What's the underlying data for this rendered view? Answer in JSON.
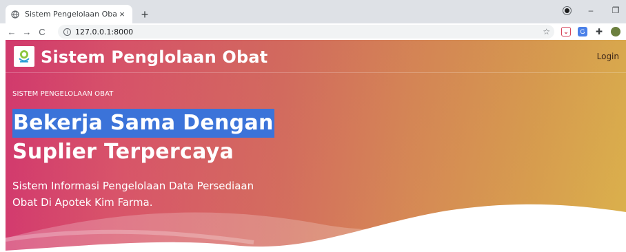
{
  "browser": {
    "tab_title": "Sistem Pengelolaan Obat",
    "tab_close": "×",
    "new_tab": "+",
    "url": "127.0.0.1:8000",
    "back": "←",
    "forward": "→",
    "reload": "C",
    "info": "i",
    "bookmark": "☆",
    "minimize": "–",
    "restore": "❐"
  },
  "navbar": {
    "brand": "Sistem Penglolaan Obat",
    "login": "Login"
  },
  "hero": {
    "kicker": "SISTEM PENGELOLAAN OBAT",
    "headline_line1": "Bekerja Sama Dengan",
    "headline_line2": "Suplier Terpercaya",
    "subtext_line1": "Sistem Informasi Pengelolaan Data Persediaan",
    "subtext_line2": "Obat Di Apotek Kim Farma."
  },
  "colors": {
    "gradient_left": "#d33b6e",
    "gradient_right": "#dbb24c",
    "selection": "#3b73d9"
  },
  "icons": [
    "globe-icon",
    "close-icon",
    "plus-icon",
    "back-arrow-icon",
    "forward-arrow-icon",
    "reload-icon",
    "info-icon",
    "star-icon",
    "pocket-icon",
    "translate-icon",
    "puzzle-icon",
    "avatar-icon",
    "profile-icon",
    "minimize-icon",
    "restore-icon",
    "logo-icon"
  ]
}
